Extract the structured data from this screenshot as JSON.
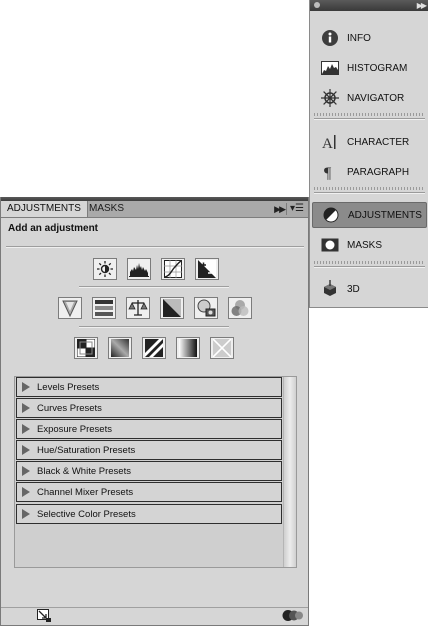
{
  "dock": {
    "items": [
      {
        "label": "INFO",
        "icon": "info-icon"
      },
      {
        "label": "HISTOGRAM",
        "icon": "histogram-icon"
      },
      {
        "label": "NAVIGATOR",
        "icon": "navigator-icon"
      },
      {
        "label": "CHARACTER",
        "icon": "character-icon"
      },
      {
        "label": "PARAGRAPH",
        "icon": "paragraph-icon"
      },
      {
        "label": "ADJUSTMENTS",
        "icon": "adjustments-icon"
      },
      {
        "label": "MASKS",
        "icon": "masks-icon"
      },
      {
        "label": "3D",
        "icon": "3d-icon"
      }
    ]
  },
  "panel": {
    "tabs": [
      "ADJUSTMENTS",
      "MASKS"
    ],
    "heading": "Add an adjustment",
    "icons_row1": [
      "brightness-contrast-icon",
      "levels-icon",
      "curves-icon",
      "exposure-icon"
    ],
    "icons_row2": [
      "vibrance-icon",
      "hue-saturation-icon",
      "color-balance-icon",
      "black-white-icon",
      "photo-filter-icon",
      "channel-mixer-icon"
    ],
    "icons_row3": [
      "invert-icon",
      "posterize-icon",
      "threshold-icon",
      "gradient-map-icon",
      "selective-color-icon"
    ],
    "presets": [
      "Levels Presets",
      "Curves Presets",
      "Exposure Presets",
      "Hue/Saturation Presets",
      "Black & White Presets",
      "Channel Mixer Presets",
      "Selective Color Presets"
    ]
  },
  "colors": {
    "panel_bg": "#d6d6d6",
    "tab_bar": "#a9a9a9",
    "active_dock": "#8b8b8b"
  }
}
